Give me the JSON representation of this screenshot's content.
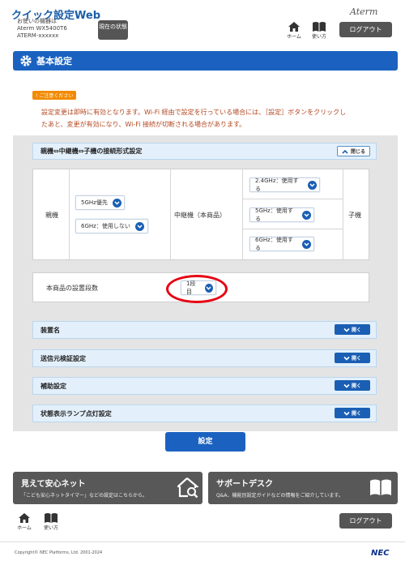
{
  "header": {
    "title": "クイック設定Web",
    "device_label": "お使いの機器は",
    "model": "Aterm WX5400T6",
    "ssid": "ATERM-xxxxxx",
    "status_button": "現在の状態",
    "brand": "Aterm",
    "nav": {
      "home": "ホーム",
      "help": "使い方"
    },
    "logout": "ログアウト"
  },
  "page": {
    "title": "基本設定",
    "notice_badge": "ご注意ください",
    "notice_line1": "設定変更は即時に有効となります。Wi-Fi 経由で設定を行っている場合には、［設定］ボタンをクリックし",
    "notice_line2": "たあと、変更が有効になり、Wi-Fi 接続が切断される場合があります。"
  },
  "connection": {
    "title": "親機⇔中継機⇔子機の接続形式設定",
    "toggle": "閉じる",
    "parent_label": "親機",
    "parent_sel1": "5GHz優先",
    "parent_sel2": "6GHz：使用しない",
    "repeater_label": "中継機（本商品）",
    "rep_sel1": "2.4GHz：使用する",
    "rep_sel2": "5GHz：使用する",
    "rep_sel3": "6GHz：使用する",
    "child_label": "子機"
  },
  "stage": {
    "label": "本商品の設置段数",
    "value": "1段目"
  },
  "sections": [
    {
      "title": "装置名",
      "toggle": "開く"
    },
    {
      "title": "送信元検証設定",
      "toggle": "開く"
    },
    {
      "title": "補助設定",
      "toggle": "開く"
    },
    {
      "title": "状態表示ランプ点灯設定",
      "toggle": "開く"
    }
  ],
  "set_button": "設定",
  "promos": {
    "left_title": "見えて安心ネット",
    "left_desc": "「こども安心ネットタイマー」などの設定はこちらから。",
    "right_title": "サポートデスク",
    "right_desc": "Q&A、機能別設定ガイドなどの情報をご紹介しています。"
  },
  "footer": {
    "home": "ホーム",
    "help": "使い方",
    "logout": "ログアウト",
    "copyright": "Copyright© NEC Platforms, Ltd. 2001-2024",
    "nec": "NEC"
  },
  "colors": {
    "accent": "#1b62c0",
    "highlight": "#e60012",
    "notice": "#f28a00"
  }
}
